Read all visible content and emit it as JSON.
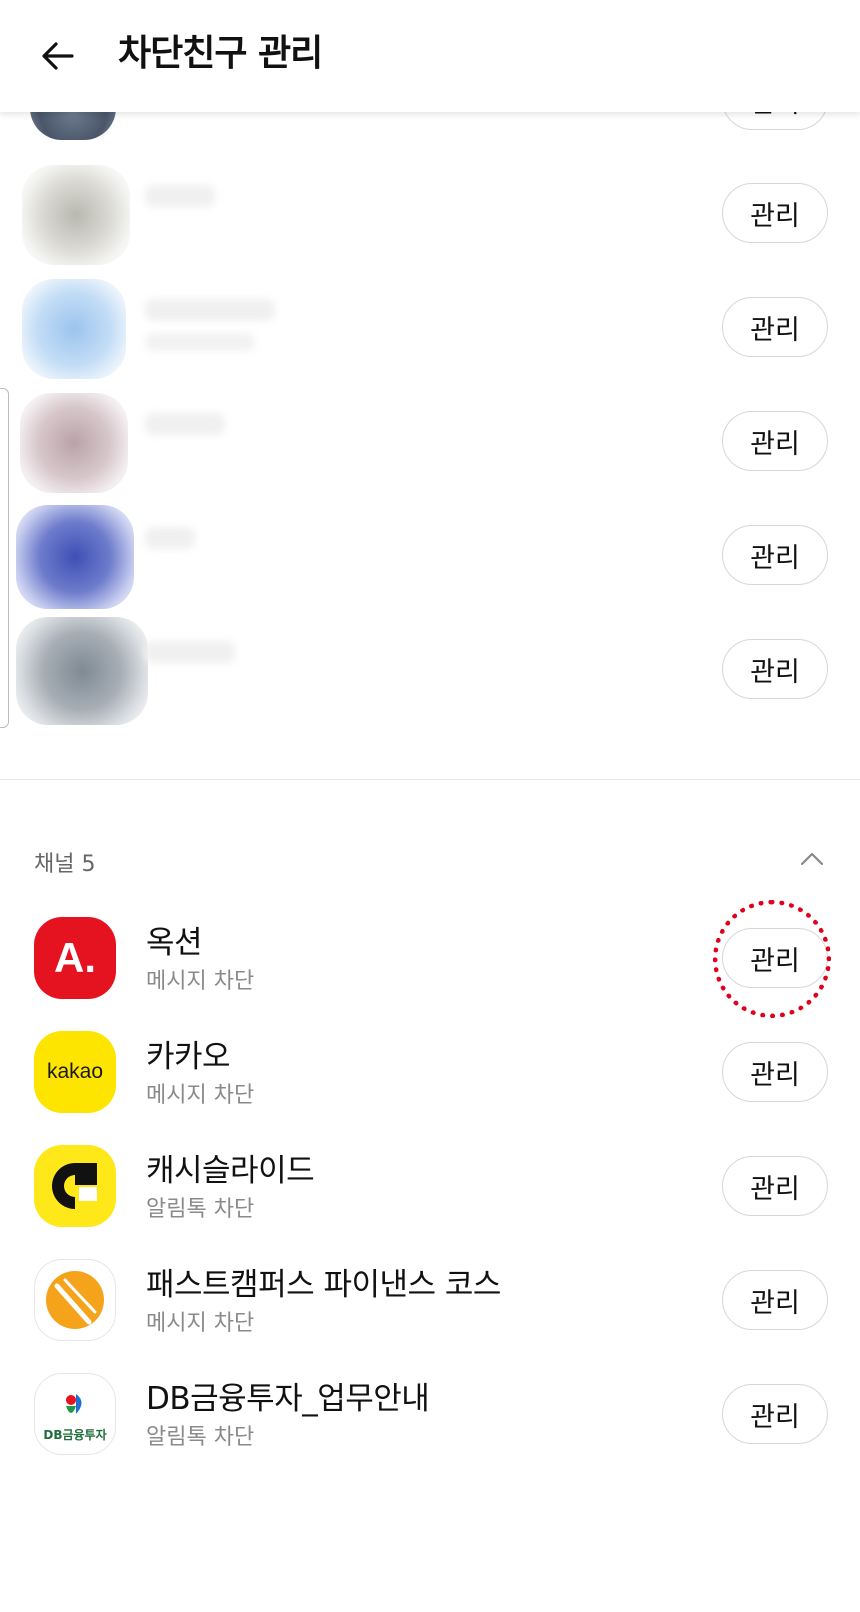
{
  "header": {
    "title": "차단친구 관리"
  },
  "friends": [
    {
      "button_label": "관리"
    },
    {
      "button_label": "관리"
    },
    {
      "button_label": "관리"
    },
    {
      "button_label": "관리"
    },
    {
      "button_label": "관리"
    },
    {
      "button_label": "관리"
    }
  ],
  "channels_section": {
    "label": "채널 5"
  },
  "channels": [
    {
      "name": "옥션",
      "status": "메시지 차단",
      "button_label": "관리",
      "icon": "auction-logo",
      "icon_text": "A."
    },
    {
      "name": "카카오",
      "status": "메시지 차단",
      "button_label": "관리",
      "icon": "kakao-logo",
      "icon_text": "kakao"
    },
    {
      "name": "캐시슬라이드",
      "status": "알림톡 차단",
      "button_label": "관리",
      "icon": "cashslide-logo"
    },
    {
      "name": "패스트캠퍼스 파이낸스 코스",
      "status": "메시지 차단",
      "button_label": "관리",
      "icon": "fastcampus-logo"
    },
    {
      "name": "DB금융투자_업무안내",
      "status": "알림톡 차단",
      "button_label": "관리",
      "icon": "db-logo",
      "icon_text": "DB금융투자"
    }
  ],
  "colors": {
    "accent_red": "#e0001b",
    "auction_red": "#e5121f",
    "kakao_yellow": "#fee500",
    "fastcampus_orange": "#f5a31a"
  }
}
